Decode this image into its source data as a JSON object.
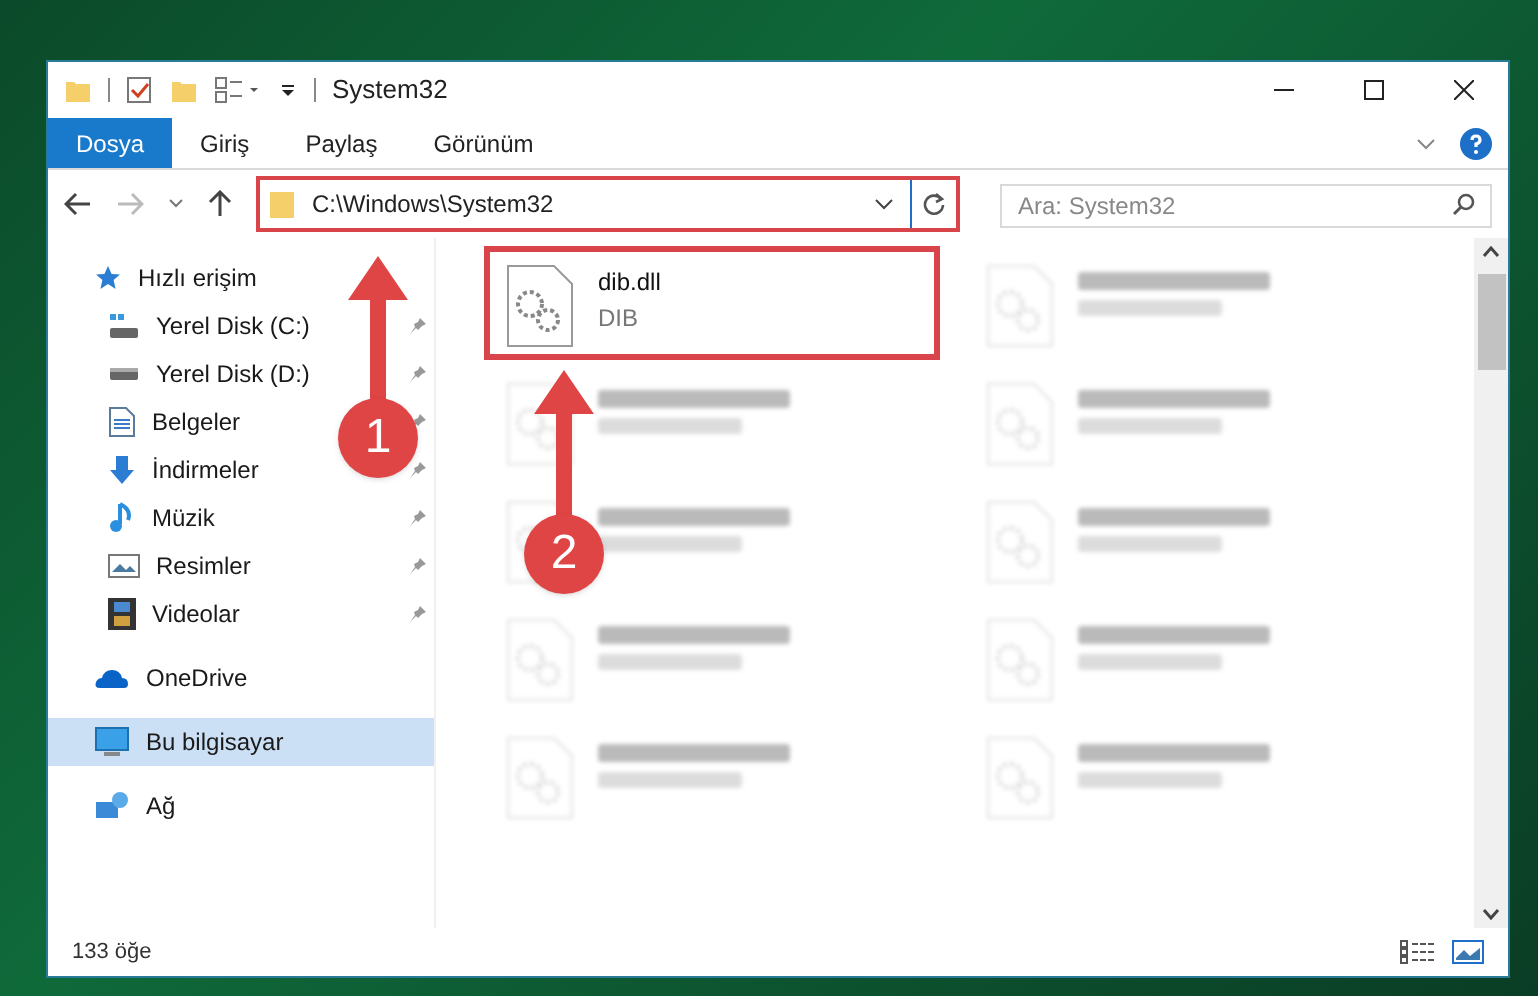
{
  "window": {
    "title": "System32"
  },
  "ribbon_tabs": [
    {
      "label": "Dosya",
      "selected": true
    },
    {
      "label": "Giriş",
      "selected": false
    },
    {
      "label": "Paylaş",
      "selected": false
    },
    {
      "label": "Görünüm",
      "selected": false
    }
  ],
  "address": {
    "value": "C:\\Windows\\System32",
    "highlighted": true
  },
  "search": {
    "placeholder": "Ara: System32"
  },
  "sidebar": {
    "items": [
      {
        "label": "Hızlı erişim",
        "kind": "quick",
        "selected": false,
        "pinned": false,
        "children": [
          {
            "label": "Yerel Disk (C:)",
            "kind": "diskc",
            "selected": false,
            "pinned": true
          },
          {
            "label": "Yerel Disk (D:)",
            "kind": "disk",
            "selected": false,
            "pinned": true
          },
          {
            "label": "Belgeler",
            "kind": "docs",
            "selected": false,
            "pinned": true
          },
          {
            "label": "İndirmeler",
            "kind": "down",
            "selected": false,
            "pinned": true
          },
          {
            "label": "Müzik",
            "kind": "music",
            "selected": false,
            "pinned": true
          },
          {
            "label": "Resimler",
            "kind": "pics",
            "selected": false,
            "pinned": true
          },
          {
            "label": "Videolar",
            "kind": "video",
            "selected": false,
            "pinned": true
          }
        ]
      },
      {
        "label": "OneDrive",
        "kind": "cloud",
        "selected": false,
        "pinned": false
      },
      {
        "label": "Bu bilgisayar",
        "kind": "pc",
        "selected": true,
        "pinned": false
      },
      {
        "label": "Ağ",
        "kind": "net",
        "selected": false,
        "pinned": false
      }
    ]
  },
  "files": [
    {
      "kind": "file",
      "name": "dib.dll",
      "type": "DIB",
      "highlighted": true
    },
    {
      "kind": "blurred"
    },
    {
      "kind": "blurred"
    },
    {
      "kind": "blurred"
    },
    {
      "kind": "blurred"
    },
    {
      "kind": "blurred"
    },
    {
      "kind": "blurred"
    },
    {
      "kind": "blurred"
    },
    {
      "kind": "blurred"
    },
    {
      "kind": "blurred"
    }
  ],
  "status_bar": {
    "count": "133 öğe"
  },
  "callouts": [
    "1",
    "2"
  ]
}
